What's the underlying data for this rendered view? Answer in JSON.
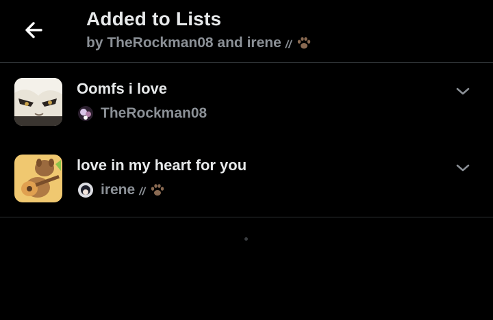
{
  "header": {
    "title": "Added to Lists",
    "subtitle_prefix": "by TheRockman08 and irene",
    "subtitle_suffix": "//",
    "back_icon": "arrow-left-icon"
  },
  "lists": [
    {
      "name": "Oomfs i love",
      "owner": "TheRockman08",
      "owner_suffix": ""
    },
    {
      "name": "love in my heart for you",
      "owner": "irene",
      "owner_suffix": "//"
    }
  ],
  "colors": {
    "background": "#000000",
    "primary_text": "#e7e9ea",
    "secondary_text": "#8b9096",
    "divider": "#2f3336"
  }
}
